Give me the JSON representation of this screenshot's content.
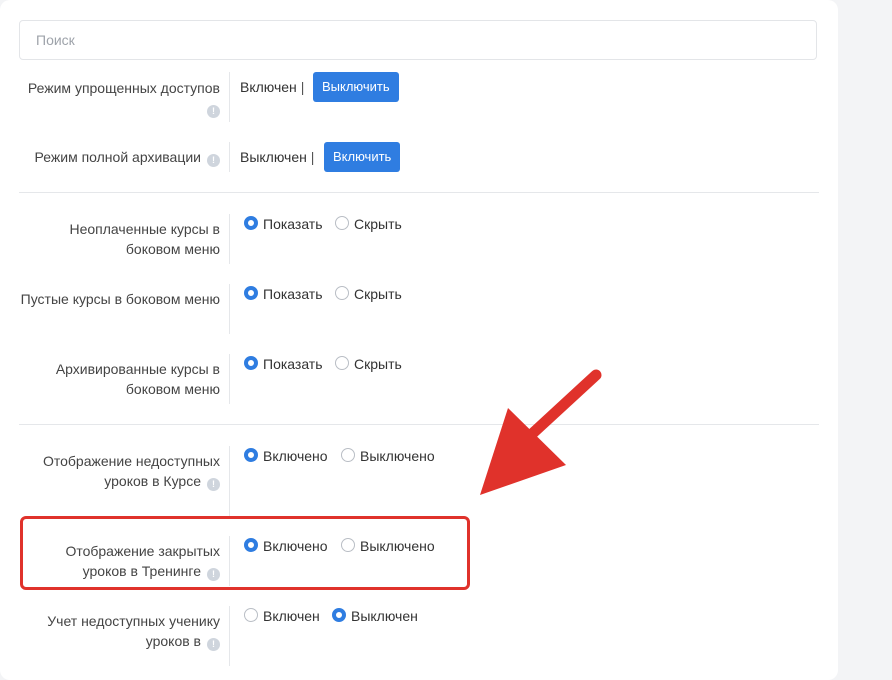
{
  "search": {
    "placeholder": "Поиск"
  },
  "modes": [
    {
      "label": "Режим упрощенных доступов",
      "status": "Включен",
      "button": "Выключить"
    },
    {
      "label": "Режим полной архивации",
      "status": "Выключен",
      "button": "Включить"
    }
  ],
  "menu_settings": [
    {
      "label": "Неоплаченные курсы в боковом меню",
      "options": [
        "Показать",
        "Скрыть"
      ],
      "selected": "Показать"
    },
    {
      "label": "Пустые курсы в боковом меню",
      "options": [
        "Показать",
        "Скрыть"
      ],
      "selected": "Показать"
    },
    {
      "label": "Архивированные курсы в боковом меню",
      "options": [
        "Показать",
        "Скрыть"
      ],
      "selected": "Показать"
    }
  ],
  "lesson_settings": [
    {
      "label": "Отображение недоступных уроков в Курсе",
      "options": [
        "Включено",
        "Выключено"
      ],
      "selected": "Включено"
    },
    {
      "label": "Отображение закрытых уроков в Тренинге",
      "options": [
        "Включено",
        "Выключено"
      ],
      "selected": "Включено"
    },
    {
      "label": "Учет недоступных ученику уроков в",
      "options": [
        "Включен",
        "Выключен"
      ],
      "selected": "Выключен"
    }
  ],
  "info_glyph": "!",
  "colors": {
    "accent": "#2f7de1",
    "annotation": "#e0322b"
  }
}
